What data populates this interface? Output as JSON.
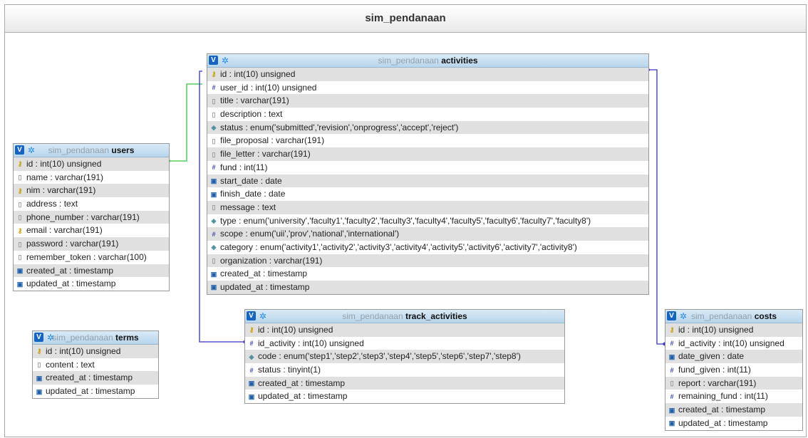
{
  "schema_title": "sim_pendanaan",
  "tables": {
    "activities": {
      "db": "sim_pendanaan",
      "name": "activities",
      "columns": [
        {
          "icon": "key-icon",
          "text": "id : int(10) unsigned"
        },
        {
          "icon": "numeric-icon",
          "text": "user_id : int(10) unsigned"
        },
        {
          "icon": "text-icon",
          "text": "title : varchar(191)"
        },
        {
          "icon": "text-icon",
          "text": "description : text"
        },
        {
          "icon": "enum-icon",
          "text": "status : enum('submitted','revision','onprogress','accept','reject')"
        },
        {
          "icon": "text-icon",
          "text": "file_proposal : varchar(191)"
        },
        {
          "icon": "text-icon",
          "text": "file_letter : varchar(191)"
        },
        {
          "icon": "numeric-icon",
          "text": "fund : int(11)"
        },
        {
          "icon": "date-icon",
          "text": "start_date : date"
        },
        {
          "icon": "date-icon",
          "text": "finish_date : date"
        },
        {
          "icon": "text-icon",
          "text": "message : text"
        },
        {
          "icon": "enum-icon",
          "text": "type : enum('university','faculty1','faculty2','faculty3','faculty4','faculty5','faculty6','faculty7','faculty8')"
        },
        {
          "icon": "numeric-icon",
          "text": "scope : enum('uii','prov','national','international')"
        },
        {
          "icon": "enum-icon",
          "text": "category : enum('activity1','activity2','activity3','activity4','activity5','activity6','activity7','activity8')"
        },
        {
          "icon": "text-icon",
          "text": "organization : varchar(191)"
        },
        {
          "icon": "date-icon",
          "text": "created_at : timestamp"
        },
        {
          "icon": "date-icon",
          "text": "updated_at : timestamp"
        }
      ]
    },
    "users": {
      "db": "sim_pendanaan",
      "name": "users",
      "columns": [
        {
          "icon": "key-icon",
          "text": "id : int(10) unsigned"
        },
        {
          "icon": "text-icon",
          "text": "name : varchar(191)"
        },
        {
          "icon": "key-icon",
          "text": "nim : varchar(191)"
        },
        {
          "icon": "text-icon",
          "text": "address : text"
        },
        {
          "icon": "text-icon",
          "text": "phone_number : varchar(191)"
        },
        {
          "icon": "key-icon",
          "text": "email : varchar(191)"
        },
        {
          "icon": "text-icon",
          "text": "password : varchar(191)"
        },
        {
          "icon": "text-icon",
          "text": "remember_token : varchar(100)"
        },
        {
          "icon": "date-icon",
          "text": "created_at : timestamp"
        },
        {
          "icon": "date-icon",
          "text": "updated_at : timestamp"
        }
      ]
    },
    "track_activities": {
      "db": "sim_pendanaan",
      "name": "track_activities",
      "columns": [
        {
          "icon": "key-icon",
          "text": "id : int(10) unsigned"
        },
        {
          "icon": "numeric-icon",
          "text": "id_activity : int(10) unsigned"
        },
        {
          "icon": "enum-icon",
          "text": "code : enum('step1','step2','step3','step4','step5','step6','step7','step8')"
        },
        {
          "icon": "numeric-icon",
          "text": "status : tinyint(1)"
        },
        {
          "icon": "date-icon",
          "text": "created_at : timestamp"
        },
        {
          "icon": "date-icon",
          "text": "updated_at : timestamp"
        }
      ]
    },
    "terms": {
      "db": "sim_pendanaan",
      "name": "terms",
      "columns": [
        {
          "icon": "key-icon",
          "text": "id : int(10) unsigned"
        },
        {
          "icon": "text-icon",
          "text": "content : text"
        },
        {
          "icon": "date-icon",
          "text": "created_at : timestamp"
        },
        {
          "icon": "date-icon",
          "text": "updated_at : timestamp"
        }
      ]
    },
    "costs": {
      "db": "sim_pendanaan",
      "name": "costs",
      "columns": [
        {
          "icon": "key-icon",
          "text": "id : int(10) unsigned"
        },
        {
          "icon": "numeric-icon",
          "text": "id_activity : int(10) unsigned"
        },
        {
          "icon": "date-icon",
          "text": "date_given : date"
        },
        {
          "icon": "numeric-icon",
          "text": "fund_given : int(11)"
        },
        {
          "icon": "text-icon",
          "text": "report : varchar(191)"
        },
        {
          "icon": "numeric-icon",
          "text": "remaining_fund : int(11)"
        },
        {
          "icon": "date-icon",
          "text": "created_at : timestamp"
        },
        {
          "icon": "date-icon",
          "text": "updated_at : timestamp"
        }
      ]
    }
  },
  "header_icons": {
    "toggle": "V",
    "options": "gear-icon"
  },
  "relation_colors": {
    "users_activities": "#2ecc40",
    "activities_track": "#3333cc",
    "activities_costs": "#3333cc"
  }
}
